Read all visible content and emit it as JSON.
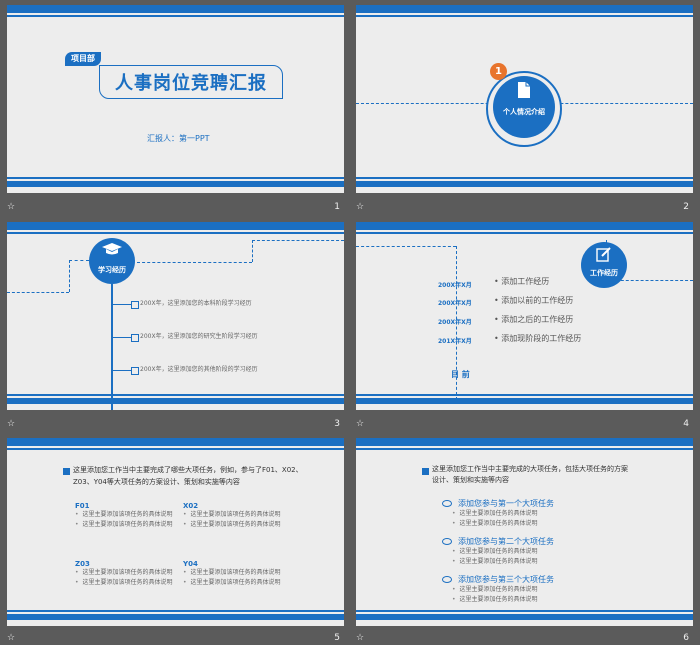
{
  "slides": [
    {
      "number": "1",
      "tag": "项目部",
      "title": "人事岗位竞聘汇报",
      "reporter": "汇报人：第一PPT"
    },
    {
      "number": "2",
      "badge": "1",
      "label": "个人情况介绍"
    },
    {
      "number": "3",
      "label": "学习经历",
      "items": [
        "200X年，这里添加您的本科阶段学习经历",
        "200X年，这里添加您的研究生阶段学习经历",
        "200X年，这里添加您的其他阶段的学习经历"
      ]
    },
    {
      "number": "4",
      "label": "工作经历",
      "dates": [
        "200X年X月",
        "200X年X月",
        "200X年X月",
        "201X年X月"
      ],
      "now": "目 前",
      "items": [
        "添加工作经历",
        "添加以前的工作经历",
        "添加之后的工作经历",
        "添加现阶段的工作经历"
      ]
    },
    {
      "number": "5",
      "intro": "这里添加您工作当中主要完成了哪些大项任务，例如，参与了F01、X02、Z03、Y04等大项任务的方案设计、策划和实施等内容",
      "groups": [
        {
          "code": "F01",
          "lines": [
            "这里主要添加该项任务的具体说明",
            "这里主要添加该项任务的具体说明"
          ]
        },
        {
          "code": "X02",
          "lines": [
            "这里主要添加该项任务的具体说明",
            "这里主要添加该项任务的具体说明"
          ]
        },
        {
          "code": "Z03",
          "lines": [
            "这里主要添加该项任务的具体说明",
            "这里主要添加该项任务的具体说明"
          ]
        },
        {
          "code": "Y04",
          "lines": [
            "这里主要添加该项任务的具体说明",
            "这里主要添加该项任务的具体说明"
          ]
        }
      ]
    },
    {
      "number": "6",
      "intro": "这里添加您工作当中主要完成的大项任务，包括大项任务的方案设计、策划和实施等内容",
      "tasks": [
        {
          "title": "添加您参与第一个大项任务",
          "lines": [
            "这里主要添加任务的具体说明",
            "这里主要添加任务的具体说明"
          ]
        },
        {
          "title": "添加您参与第二个大项任务",
          "lines": [
            "这里主要添加任务的具体说明",
            "这里主要添加任务的具体说明"
          ]
        },
        {
          "title": "添加您参与第三个大项任务",
          "lines": [
            "这里主要添加任务的具体说明",
            "这里主要添加任务的具体说明"
          ]
        }
      ]
    }
  ],
  "footer_left": "☆",
  "colors": {
    "accent": "#1b6fc2",
    "badge": "#e8742c",
    "background": "#5b5b5b",
    "slide": "#ededed"
  }
}
